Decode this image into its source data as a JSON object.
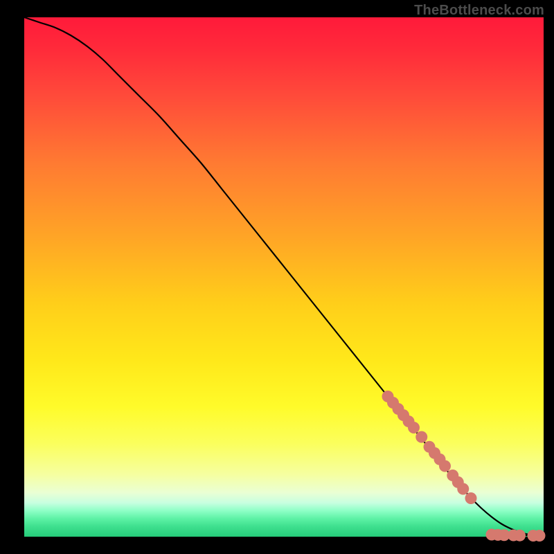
{
  "watermark": "TheBottleneck.com",
  "colors": {
    "background": "#000000",
    "curve": "#000000",
    "marker": "#d5796e"
  },
  "chart_data": {
    "type": "line",
    "title": "",
    "xlabel": "",
    "ylabel": "",
    "xlim": [
      0,
      100
    ],
    "ylim": [
      0,
      100
    ],
    "grid": false,
    "legend": false,
    "series": [
      {
        "name": "bottleneck-curve",
        "x": [
          0,
          3,
          6,
          9,
          12,
          15,
          18,
          22,
          26,
          30,
          34,
          38,
          42,
          46,
          50,
          54,
          58,
          62,
          66,
          70,
          74,
          78,
          82,
          86,
          88,
          90,
          92,
          94,
          96,
          98,
          100
        ],
        "y": [
          100,
          99,
          98,
          96.5,
          94.5,
          92,
          89,
          85,
          81,
          76.5,
          72,
          67,
          62,
          57,
          52,
          47,
          42,
          37,
          32,
          27,
          22,
          17,
          12,
          7.5,
          5.5,
          3.8,
          2.4,
          1.4,
          0.7,
          0.25,
          0.0
        ]
      }
    ],
    "markers": {
      "name": "highlighted-points",
      "points": [
        {
          "x": 70.0,
          "y": 27.0
        },
        {
          "x": 71.0,
          "y": 25.8
        },
        {
          "x": 72.0,
          "y": 24.6
        },
        {
          "x": 73.0,
          "y": 23.4
        },
        {
          "x": 74.0,
          "y": 22.2
        },
        {
          "x": 75.0,
          "y": 21.0
        },
        {
          "x": 76.5,
          "y": 19.2
        },
        {
          "x": 78.0,
          "y": 17.3
        },
        {
          "x": 79.0,
          "y": 16.1
        },
        {
          "x": 80.0,
          "y": 14.9
        },
        {
          "x": 81.0,
          "y": 13.6
        },
        {
          "x": 82.5,
          "y": 11.8
        },
        {
          "x": 83.5,
          "y": 10.5
        },
        {
          "x": 84.5,
          "y": 9.2
        },
        {
          "x": 86.0,
          "y": 7.4
        },
        {
          "x": 90.0,
          "y": 0.4
        },
        {
          "x": 91.2,
          "y": 0.35
        },
        {
          "x": 92.4,
          "y": 0.3
        },
        {
          "x": 94.2,
          "y": 0.26
        },
        {
          "x": 95.4,
          "y": 0.24
        },
        {
          "x": 98.0,
          "y": 0.2
        },
        {
          "x": 99.2,
          "y": 0.2
        }
      ]
    },
    "gradient_stops": [
      {
        "pos": 0.0,
        "color": "#ff1a3a"
      },
      {
        "pos": 0.28,
        "color": "#ff7a32"
      },
      {
        "pos": 0.55,
        "color": "#ffce1a"
      },
      {
        "pos": 0.82,
        "color": "#fbff5c"
      },
      {
        "pos": 0.95,
        "color": "#8effc6"
      },
      {
        "pos": 1.0,
        "color": "#26cc7a"
      }
    ]
  }
}
